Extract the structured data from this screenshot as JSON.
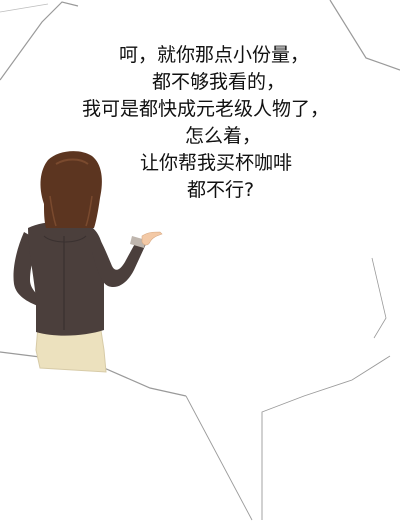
{
  "speech_bubble": {
    "lines": [
      "呵，就你那点小份量，",
      "都不够我看的，",
      "我可是都快成元老级人物了，",
      "怎么着，",
      "让你帮我买杯咖啡",
      "都不行?"
    ]
  },
  "colors": {
    "hair": "#5c3520",
    "hair_highlight": "#7a4a2e",
    "jacket": "#4b3f3c",
    "jacket_dark": "#3a3130",
    "skin": "#f3c9a6",
    "skirt": "#ece1be",
    "outline": "#8a8a8a"
  },
  "icons": [
    "woman-pointing-illustration",
    "speech-bubble-outline"
  ]
}
